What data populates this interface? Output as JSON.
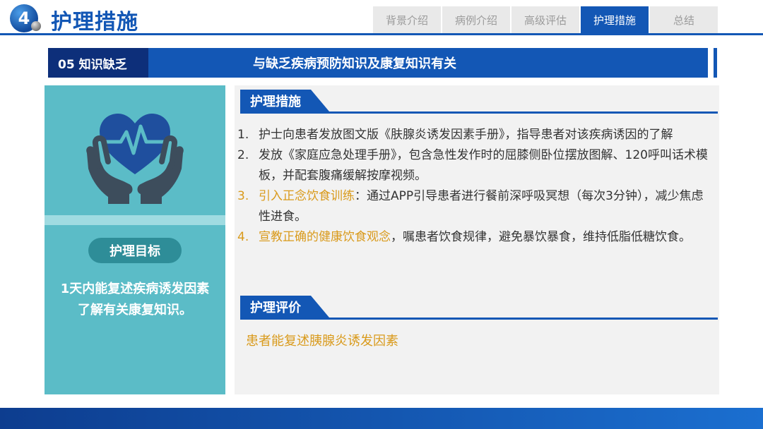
{
  "header": {
    "section_number": "4",
    "title": "护理措施",
    "tabs": [
      {
        "label": "背景介绍",
        "active": false
      },
      {
        "label": "病例介绍",
        "active": false
      },
      {
        "label": "高级评估",
        "active": false
      },
      {
        "label": "护理措施",
        "active": true
      },
      {
        "label": "总结",
        "active": false
      }
    ]
  },
  "banner": {
    "tag": "05  知识缺乏",
    "text": "与缺乏疾病预防知识及康复知识有关"
  },
  "left_panel": {
    "icon": "hands-holding-heart-icon",
    "goal_label": "护理目标",
    "goal_text_lines": [
      "1天内能复述疾病诱发因素",
      "了解有关康复知识。"
    ]
  },
  "measures": {
    "heading": "护理措施",
    "items": [
      {
        "num": "1.",
        "highlight": "",
        "text": "护士向患者发放图文版《肤腺炎诱发因素手册》，指导患者对该疾病诱因的了解"
      },
      {
        "num": "2.",
        "highlight": "",
        "text": "发放《家庭应急处理手册》，包含急性发作时的屈膝侧卧位摆放图解、120呼叫话术模板，并配套腹痛缓解按摩视频。"
      },
      {
        "num": "3.",
        "highlight": "引入正念饮食训练",
        "text": "：通过APP引导患者进行餐前深呼吸冥想（每次3分钟），减少焦虑性进食。"
      },
      {
        "num": "4.",
        "highlight": "宣教正确的健康饮食观念",
        "text": "，嘱患者饮食规律，避免暴饮暴食，维持低脂低糖饮食。"
      }
    ]
  },
  "evaluation": {
    "heading": "护理评价",
    "text": "患者能复述胰腺炎诱发因素"
  },
  "colors": {
    "primary": "#1357b5",
    "dark": "#0d2f7a",
    "teal": "#5bbcc7",
    "accent": "#d99a1b"
  }
}
